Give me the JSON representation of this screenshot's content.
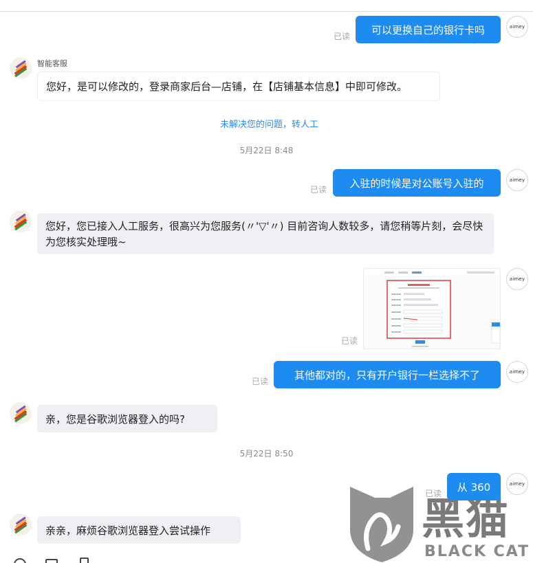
{
  "chat": {
    "messages": [
      {
        "side": "out",
        "text": "可以更换自己的银行卡吗",
        "status": "已读"
      },
      {
        "side": "in",
        "sender": "智能客服",
        "text": "您好，是可以修改的，登录商家后台—店铺，在【店铺基本信息】中即可修改。"
      },
      {
        "side": "out",
        "text": "入驻的时候是对公账号入驻的",
        "status": "已读"
      },
      {
        "side": "in",
        "text": "您好，您已接入人工服务，很高兴为您服务(〃'▽'〃) 目前咨询人数较多，请您稍等片刻，会尽快为您核实处理哦~"
      },
      {
        "side": "out",
        "type": "image",
        "status": "已读"
      },
      {
        "side": "out",
        "text": "其他都对的，只有开户银行一栏选择不了",
        "status": "已读"
      },
      {
        "side": "in",
        "text": "亲，您是谷歌浏览器登入的吗?"
      },
      {
        "side": "out",
        "text": "从 360",
        "status": "已读"
      },
      {
        "side": "in",
        "text": "亲亲，麻烦谷歌浏览器登入尝试操作"
      }
    ],
    "transfer_link": "未解决您的问题，转人工",
    "timestamps": [
      "5月22日 8:48",
      "5月22日 8:50"
    ],
    "user_avatar_text": "aimey"
  },
  "watermark": {
    "chinese": "黑猫",
    "english": "BLACK CAT"
  },
  "colors": {
    "bubble_out": "#1e8bf0",
    "bubble_in": "#eef0f3",
    "link": "#2f8be6",
    "read": "#a8a8a8"
  }
}
